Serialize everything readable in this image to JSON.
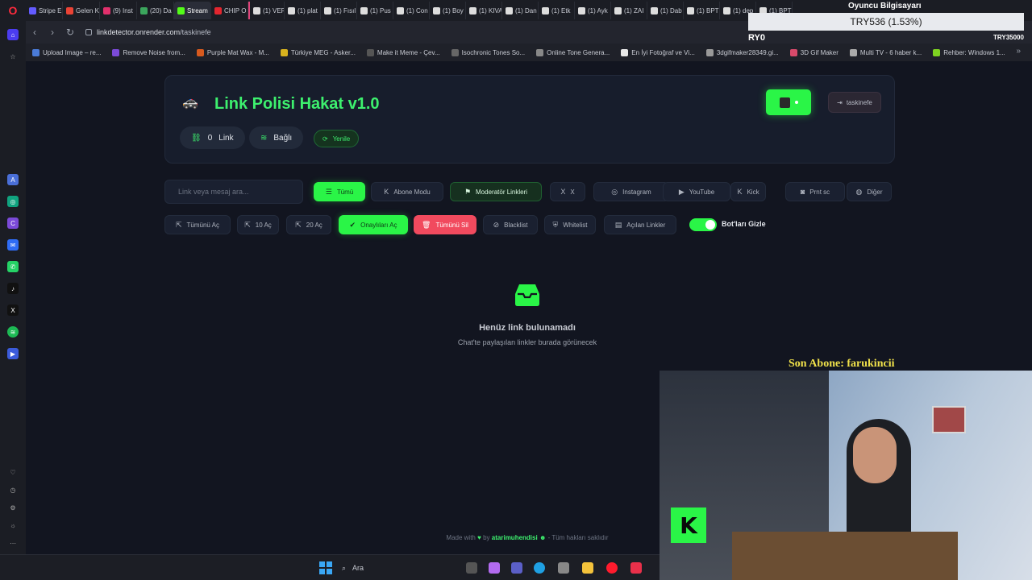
{
  "browser": {
    "tabs": [
      {
        "label": "Stripe E",
        "color": "#635bff"
      },
      {
        "label": "Gelen K",
        "color": "#ea4335"
      },
      {
        "label": "(9) Inst",
        "color": "#e1306c"
      },
      {
        "label": "(20) Da",
        "color": "#3ba55c"
      },
      {
        "label": "Stream",
        "color": "#53fc18",
        "active": true
      },
      {
        "label": "CHIP O",
        "color": "#e3262f"
      },
      {
        "label": "(1) VER",
        "color": "#dddddd",
        "pink": true
      },
      {
        "label": "(1) plat",
        "color": "#dddddd"
      },
      {
        "label": "(1) Fısıl",
        "color": "#dddddd"
      },
      {
        "label": "(1) Pus",
        "color": "#dddddd"
      },
      {
        "label": "(1) Con",
        "color": "#dddddd"
      },
      {
        "label": "(1) Boy",
        "color": "#dddddd"
      },
      {
        "label": "(1) KIVA",
        "color": "#dddddd"
      },
      {
        "label": "(1) Dan",
        "color": "#dddddd"
      },
      {
        "label": "(1) Etk",
        "color": "#dddddd"
      },
      {
        "label": "(1) Ayk",
        "color": "#dddddd"
      },
      {
        "label": "(1) ZAI",
        "color": "#dddddd"
      },
      {
        "label": "(1) Dab",
        "color": "#dddddd"
      },
      {
        "label": "(1) BPT",
        "color": "#dddddd"
      },
      {
        "label": "(1) dep",
        "color": "#dddddd"
      },
      {
        "label": "(1) BPT",
        "color": "#dddddd"
      }
    ],
    "url_host": "linkdetector.onrender.com",
    "url_path": "/taskinefe",
    "bookmarks": [
      {
        "label": "Upload Image – re...",
        "color": "#4a7bd8"
      },
      {
        "label": "Remove Noise from...",
        "color": "#7b4ad8"
      },
      {
        "label": "Purple Mat Wax - M...",
        "color": "#d85a1e"
      },
      {
        "label": "Türkiye MEG - Asker...",
        "color": "#d8b21e"
      },
      {
        "label": "Make it Meme - Çev...",
        "color": "#555555"
      },
      {
        "label": "Isochronic Tones So...",
        "color": "#666666"
      },
      {
        "label": "Online Tone Genera...",
        "color": "#888888"
      },
      {
        "label": "En İyi Fotoğraf ve Vi...",
        "color": "#e8e8e8"
      },
      {
        "label": "3dgifmaker28349.gi...",
        "color": "#999999"
      },
      {
        "label": "3D Gif Maker",
        "color": "#d84a6b"
      },
      {
        "label": "Multi TV - 6 haber k...",
        "color": "#aaaaaa"
      },
      {
        "label": "Rehber: Windows 1...",
        "color": "#7ed321"
      }
    ]
  },
  "app": {
    "title": "Link Polisi Hakat v1.0",
    "link_count": "0",
    "link_label": "Link",
    "connection": "Bağlı",
    "refresh_label": "Yenile",
    "logout_label": "taskinefe"
  },
  "search": {
    "placeholder": "Link veya mesaj ara..."
  },
  "filters": [
    {
      "label": "Tümü",
      "icon": "☰"
    },
    {
      "label": "Abone Modu",
      "icon": "K"
    },
    {
      "label": "Moderatör Linkleri",
      "icon": "⚑"
    },
    {
      "label": "X",
      "icon": "X"
    },
    {
      "label": "Instagram",
      "icon": "◎"
    },
    {
      "label": "YouTube",
      "icon": "▶"
    },
    {
      "label": "Kick",
      "icon": "K"
    },
    {
      "label": "Prnt sc",
      "icon": "◙"
    },
    {
      "label": "Diğer",
      "icon": "◍"
    }
  ],
  "actions": [
    {
      "label": "Tümünü Aç",
      "icon": "⇱"
    },
    {
      "label": "10 Aç",
      "icon": "⇱"
    },
    {
      "label": "20 Aç",
      "icon": "⇱"
    },
    {
      "label": "Onaylıları Aç",
      "icon": "✔"
    },
    {
      "label": "Tümünü Sil",
      "icon": "🗑"
    },
    {
      "label": "Blacklist",
      "icon": "⊘"
    },
    {
      "label": "Whitelist",
      "icon": "⛨"
    },
    {
      "label": "Açılan Linkler",
      "icon": "▤"
    }
  ],
  "toggle": {
    "label": "Bot'ları Gizle",
    "on": true
  },
  "empty": {
    "title": "Henüz link bulunamadı",
    "subtitle": "Chat'te paylaşılan linkler burada görünecek"
  },
  "footer": {
    "prefix": "Made with",
    "by": "by",
    "author": "atarimuhendisi",
    "suffix": "- Tüm hakları saklıdır"
  },
  "taskbar": {
    "search_label": "Ara"
  },
  "overlay": {
    "title": "Oyuncu Bilgisayarı",
    "price": "TRY536 (1.53%)",
    "left_code": "RY0",
    "right_code": "TRY35000",
    "sub_label": "Son Abone: farukincii"
  },
  "colors": {
    "accent": "#2af547",
    "title_green": "#3df06e",
    "danger": "#f14a5e",
    "background": "#121520"
  }
}
